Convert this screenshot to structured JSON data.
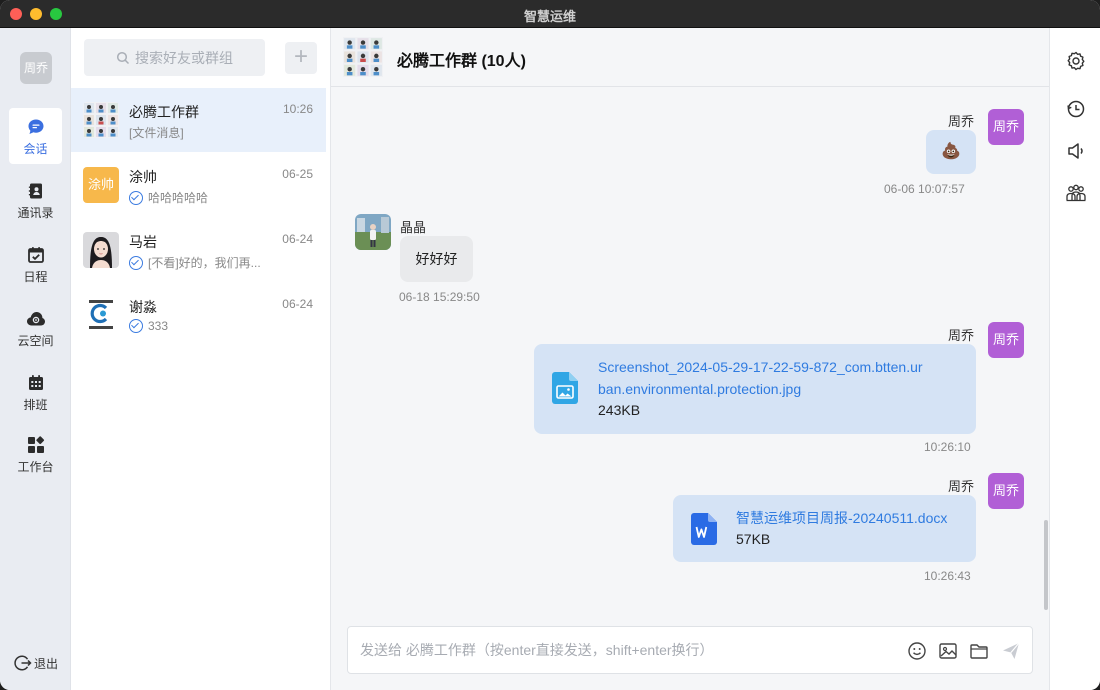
{
  "window": {
    "title": "智慧运维"
  },
  "nav": {
    "me_avatar": "周乔",
    "items": [
      {
        "label": "会话",
        "icon": "chat-bubble-icon",
        "active": true
      },
      {
        "label": "通讯录",
        "icon": "address-book-icon"
      },
      {
        "label": "日程",
        "icon": "calendar-check-icon"
      },
      {
        "label": "云空间",
        "icon": "cloud-icon"
      },
      {
        "label": "排班",
        "icon": "schedule-grid-icon"
      },
      {
        "label": "工作台",
        "icon": "apps-icon"
      }
    ],
    "logout": "退出"
  },
  "search": {
    "placeholder": "搜索好友或群组"
  },
  "conversations": [
    {
      "name": "必腾工作群",
      "time": "10:26",
      "preview": "[文件消息]",
      "read": false
    },
    {
      "name": "涂帅",
      "avatar_text": "涂帅",
      "avatar_color": "#f7b84b",
      "time": "06-25",
      "preview": "哈哈哈哈哈",
      "read": true
    },
    {
      "name": "马岩",
      "time": "06-24",
      "preview": "[不看]好的，我们再...",
      "read": true
    },
    {
      "name": "谢淼",
      "time": "06-24",
      "preview": "333",
      "read": true
    }
  ],
  "chat": {
    "title": "必腾工作群 (10人)",
    "messages": [
      {
        "sender": "周乔",
        "avatar": "周乔",
        "content": "💩",
        "time": "06-06 10:07:57"
      },
      {
        "sender": "晶晶",
        "content": "好好好",
        "time": "06-18 15:29:50"
      },
      {
        "sender": "周乔",
        "avatar": "周乔",
        "file_name_line1": "Screenshot_2024-05-29-17-22-59-872_com.btten.ur",
        "file_name_line2": "ban.environmental.protection.jpg",
        "file_size": "243KB",
        "time": "10:26:10"
      },
      {
        "sender": "周乔",
        "avatar": "周乔",
        "file_name": "智慧运维项目周报-20240511.docx",
        "file_size": "57KB",
        "time": "10:26:43"
      }
    ],
    "input_placeholder": "发送给 必腾工作群（按enter直接发送，shift+enter换行）"
  }
}
